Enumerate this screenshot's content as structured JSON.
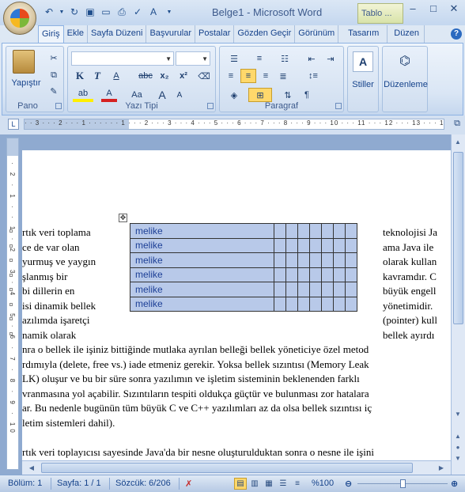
{
  "title_bar": {
    "title": "Belge1 - Microsoft Word",
    "context_tab": "Tablo ..."
  },
  "tabs": [
    "Giriş",
    "Ekle",
    "Sayfa Düzeni",
    "Başvurular",
    "Postalar",
    "Gözden Geçir",
    "Görünüm",
    "Tasarım",
    "Düzen"
  ],
  "ribbon": {
    "clipboard": {
      "label": "Pano",
      "paste": "Yapıştır"
    },
    "font": {
      "label": "Yazı Tipi",
      "bold": "K",
      "italic": "T",
      "underline": "A",
      "strike": "abc",
      "sub": "x₂",
      "sup": "x²",
      "grow": "A",
      "shrink": "A",
      "case": "Aa"
    },
    "paragraph": {
      "label": "Paragraf"
    },
    "styles": {
      "label": "Stiller"
    },
    "editing": {
      "label": "Düzenleme"
    }
  },
  "ruler": {
    "horizontal": "· · 3 · · · 2 · · · 1 · · ·  · · · 1 · · · 2 · · · 3 · · · 4 · · · 5 · · · 6 · · · 7 · · · 8 · · · 9 · · · 10 · · · 11 · · · 12 · · · 13 · · · 14 · · · 15 · · · 16 ·",
    "vertical": "·  2 · 1 ·  · 1 · 2 · 3 · 4 · 5 · 6 · 7 · 8 · 9 · 10"
  },
  "document": {
    "left_lines": [
      "rtık veri toplama",
      "ce de var olan",
      "yurmuş ve yaygın",
      "şlanmış bir",
      "bi dillerin en",
      "isi dinamik bellek",
      "azılımda işaretçi",
      "namik olarak"
    ],
    "right_lines": [
      "teknolojisi Ja",
      "ama Java ile",
      "olarak kullan",
      "kavramdır. C",
      "büyük engell",
      "yönetimidir.",
      "(pointer) kull",
      "bellek ayırdı"
    ],
    "table_rows": [
      "melike",
      "melike",
      "melike",
      "melike",
      "melike",
      "melike"
    ],
    "table_extra_cols": 7,
    "full_lines": [
      "nra o bellek ile işiniz bittiğinde mutlaka ayrılan belleği bellek yöneticiye özel metod",
      "rdımıyla (delete, free vs.) iade etmeniz gerekir. Yoksa bellek sızıntısı (Memory Leak",
      "LK) oluşur ve bu bir süre sonra yazılımın ve işletim sisteminin beklenenden farklı",
      "vranmasına yol açabilir. Sızıntıların tespiti oldukça güçtür ve bulunması zor hatalara",
      "ar. Bu nedenle bugünün tüm büyük C ve C++ yazılımları az da olsa bellek sızıntısı iç",
      "letim sistemleri dahil).",
      "",
      "rtık veri toplayıcısı sayesinde Java'da bir nesne oluşturulduktan sonra o nesne ile işini"
    ]
  },
  "status_bar": {
    "section": "Bölüm: 1",
    "page": "Sayfa: 1 / 1",
    "words": "Sözcük: 6/206",
    "zoom": "%100",
    "zoom_level": 100
  }
}
